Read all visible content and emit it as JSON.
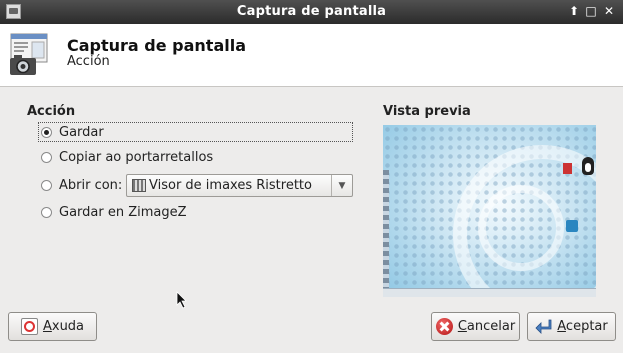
{
  "window": {
    "title": "Captura de pantalla",
    "controls": {
      "restore": "⬆",
      "maximize": "□",
      "close": "✕"
    }
  },
  "header": {
    "title": "Captura de pantalla",
    "subtitle": "Acción",
    "icon": "screenshot-camera-icon"
  },
  "action": {
    "section_label": "Acción",
    "options": [
      {
        "label": "Gardar",
        "selected": true
      },
      {
        "label": "Copiar ao portarretallos",
        "selected": false
      },
      {
        "label": "Abrir con:",
        "selected": false
      },
      {
        "label": "Gardar en ZimageZ",
        "selected": false
      }
    ],
    "open_with": {
      "value": "Visor de imaxes Ristretto",
      "icon": "image-viewer-icon"
    }
  },
  "preview": {
    "section_label": "Vista previa"
  },
  "buttons": {
    "help": {
      "label_underlined": "A",
      "label_rest": "xuda",
      "icon": "help-icon"
    },
    "cancel": {
      "label_underlined": "C",
      "label_rest": "ancelar",
      "icon": "cancel-icon"
    },
    "accept": {
      "label_underlined": "A",
      "label_rest": "ceptar",
      "icon": "accept-arrow-icon"
    }
  }
}
